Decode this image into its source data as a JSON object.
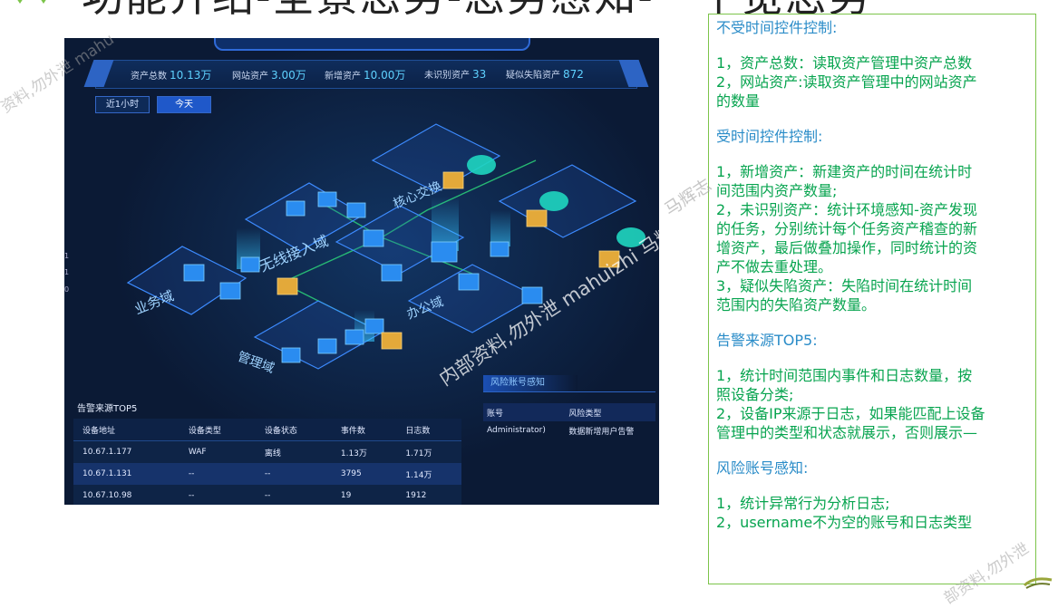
{
  "slide": {
    "title": "功能介绍-全景态势-态势感知-一个览态势"
  },
  "dashboard": {
    "stats": [
      {
        "label": "资产总数",
        "value": "10.13万"
      },
      {
        "label": "网站资产",
        "value": "3.00万"
      },
      {
        "label": "新增资产",
        "value": "10.00万"
      },
      {
        "label": "未识别资产",
        "value": "33"
      },
      {
        "label": "疑似失陷资产",
        "value": "872"
      }
    ],
    "time_filters": [
      "近1小时",
      "今天"
    ],
    "time_filter_active": "今天",
    "map_labels": {
      "wireless": "无线接入域",
      "core": "核心交换",
      "business": "业务域",
      "management": "管理域",
      "office": "办公域"
    },
    "side_digits": [
      "1",
      "1",
      "0"
    ],
    "alert_sources": {
      "title": "告警来源TOP5",
      "columns": [
        "设备地址",
        "设备类型",
        "设备状态",
        "事件数",
        "日志数"
      ],
      "rows": [
        [
          "10.67.1.177",
          "WAF",
          "离线",
          "1.13万",
          "1.71万"
        ],
        [
          "10.67.1.131",
          "--",
          "--",
          "3795",
          "1.14万"
        ],
        [
          "10.67.10.98",
          "--",
          "--",
          "19",
          "1912"
        ]
      ]
    },
    "risk_accounts": {
      "title": "风险账号感知",
      "columns": [
        "账号",
        "风险类型"
      ],
      "rows": [
        [
          "Administrator)",
          "数据新增用户告警"
        ]
      ]
    }
  },
  "notes": {
    "lines": [
      {
        "type": "head",
        "text": "不受时间控件控制:"
      },
      {
        "type": "gap",
        "text": ""
      },
      {
        "type": "text",
        "text": "1，资产总数：读取资产管理中资产总数"
      },
      {
        "type": "text",
        "text": "2，网站资产:读取资产管理中的网站资产"
      },
      {
        "type": "text",
        "text": "的数量"
      },
      {
        "type": "gap",
        "text": ""
      },
      {
        "type": "head",
        "text": "受时间控件控制:"
      },
      {
        "type": "gap",
        "text": ""
      },
      {
        "type": "text",
        "text": "1，新增资产：新建资产的时间在统计时"
      },
      {
        "type": "text",
        "text": "间范围内资产数量;"
      },
      {
        "type": "text",
        "text": "2，未识别资产：统计环境感知-资产发现"
      },
      {
        "type": "text",
        "text": "的任务，分别统计每个任务资产稽查的新"
      },
      {
        "type": "text",
        "text": "增资产，最后做叠加操作，同时统计的资"
      },
      {
        "type": "text",
        "text": "产不做去重处理。"
      },
      {
        "type": "text",
        "text": "3，疑似失陷资产：失陷时间在统计时间"
      },
      {
        "type": "text",
        "text": "范围内的失陷资产数量。"
      },
      {
        "type": "gap",
        "text": ""
      },
      {
        "type": "head",
        "text": "告警来源TOP5:"
      },
      {
        "type": "gap",
        "text": ""
      },
      {
        "type": "text",
        "text": "1，统计时间范围内事件和日志数量，按"
      },
      {
        "type": "text",
        "text": "照设备分类;"
      },
      {
        "type": "text",
        "text": "2，设备IP来源于日志，如果能匹配上设备"
      },
      {
        "type": "text",
        "text": "管理中的类型和状态就展示，否则展示—"
      },
      {
        "type": "gap",
        "text": ""
      },
      {
        "type": "head",
        "text": "风险账号感知:"
      },
      {
        "type": "gap",
        "text": ""
      },
      {
        "type": "text",
        "text": "1，统计异常行为分析日志;"
      },
      {
        "type": "text",
        "text": "2，username不为空的账号和日志类型"
      }
    ]
  },
  "watermarks": {
    "center": "内部资料,勿外泄 mahuizhi 马辉志",
    "top_left": "资料,勿外泄 mahu",
    "right": "马辉志",
    "bottom_right": "部资料,勿外泄"
  },
  "colors": {
    "note_text": "#07a44f",
    "note_head": "#2a8cc8",
    "dash_bg": "#0b1a35",
    "accent": "#5fd2ff"
  }
}
